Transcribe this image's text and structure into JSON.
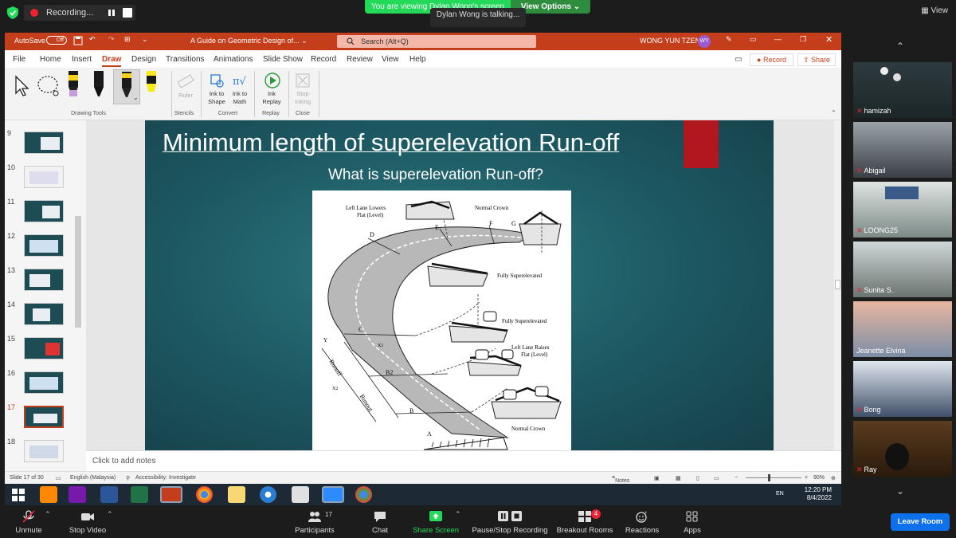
{
  "zoom": {
    "recording_label": "Recording...",
    "banner_text": "You are viewing Dylan Wong's screen",
    "view_options": "View Options",
    "talking_text": "Dylan Wong is talking...",
    "view_label": "View",
    "toolbar": {
      "unmute": "Unmute",
      "stop_video": "Stop Video",
      "participants": "Participants",
      "participants_count": "17",
      "chat": "Chat",
      "share_screen": "Share Screen",
      "pause_recording": "Pause/Stop Recording",
      "breakout_rooms": "Breakout Rooms",
      "breakout_badge": "4",
      "reactions": "Reactions",
      "apps": "Apps",
      "leave": "Leave Room"
    },
    "participants": [
      {
        "name": "hamizah"
      },
      {
        "name": "Abigail"
      },
      {
        "name": "LOONG25"
      },
      {
        "name": "Sunita S."
      },
      {
        "name": "Jeanette Elvina"
      },
      {
        "name": "Bong"
      },
      {
        "name": "Ray"
      }
    ]
  },
  "ppt": {
    "autosave_label": "AutoSave",
    "autosave_state": "Off",
    "doc_title": "A Guide on Geometric Design of...",
    "search_placeholder": "Search (Alt+Q)",
    "user_name": "WONG YUN TZEN",
    "user_initials": "WY",
    "menu": [
      "File",
      "Home",
      "Insert",
      "Draw",
      "Design",
      "Transitions",
      "Animations",
      "Slide Show",
      "Record",
      "Review",
      "View",
      "Help"
    ],
    "active_menu": "Draw",
    "record_btn": "Record",
    "share_btn": "Share",
    "ribbon": {
      "drawing_tools": "Drawing Tools",
      "ruler": "Ruler",
      "stencils": "Stencils",
      "ink_to_shape": "Ink to Shape",
      "ink_to_math": "Ink to Math",
      "convert": "Convert",
      "ink_replay": "Ink Replay",
      "replay": "Replay",
      "stop_inking": "Stop Inking",
      "close": "Close"
    },
    "slide_numbers": [
      "9",
      "10",
      "11",
      "12",
      "13",
      "14",
      "15",
      "16",
      "17",
      "18"
    ],
    "active_slide": "17",
    "slide": {
      "title": "Minimum length of superelevation Run-off",
      "subtitle": "What is superelevation Run-off?",
      "diagram_labels": {
        "left_lane_lowers": "Left Lane Lowers",
        "flat_level": "Flat (Level)",
        "normal_crown_top": "Normal Crown",
        "fully_super_1": "Fully Superelevated",
        "fully_super_2": "Fully Superelevated",
        "left_lane_raises": "Left Lane Raises",
        "flat_level_2": "Flat (Level)",
        "normal_crown_bottom": "Normal Crown",
        "D": "D",
        "E": "E",
        "F": "F",
        "G": "G",
        "C": "C",
        "B2": "B2",
        "B": "B",
        "A": "A",
        "X1": "X1",
        "X2": "X2",
        "Y": "Y",
        "runoff": "Runoff",
        "runout": "Runout"
      }
    },
    "notes_placeholder": "Click to add notes",
    "status": {
      "slide_of": "Slide 17 of 30",
      "language": "English (Malaysia)",
      "accessibility": "Accessibility: Investigate",
      "notes": "Notes",
      "zoom": "90%"
    }
  },
  "taskbar": {
    "time": "12:20 PM",
    "date": "8/4/2022",
    "lang": "EN"
  }
}
